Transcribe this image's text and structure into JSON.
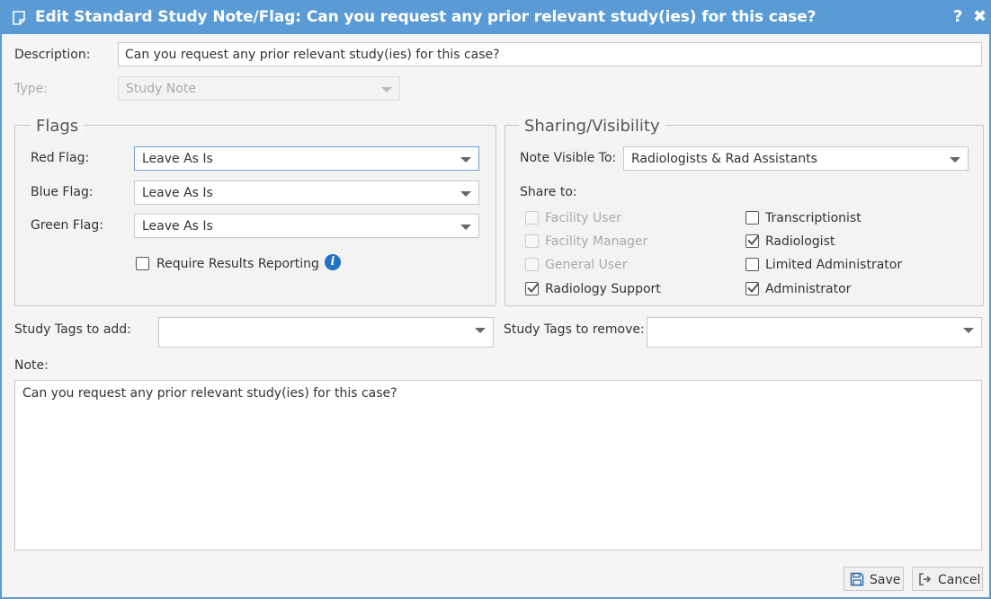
{
  "window": {
    "title": "Edit Standard Study Note/Flag: Can you request any prior relevant study(ies) for this case?",
    "help_label": "?",
    "close_label": "✖"
  },
  "description": {
    "label": "Description:",
    "value": "Can you request any prior relevant study(ies) for this case?"
  },
  "type": {
    "label": "Type:",
    "value": "Study Note"
  },
  "flags": {
    "legend": "Flags",
    "red": {
      "label": "Red Flag:",
      "value": "Leave As Is"
    },
    "blue": {
      "label": "Blue Flag:",
      "value": "Leave As Is"
    },
    "green": {
      "label": "Green Flag:",
      "value": "Leave As Is"
    },
    "require_results": {
      "label": "Require Results Reporting",
      "checked": false
    }
  },
  "sharing": {
    "legend": "Sharing/Visibility",
    "visible_to": {
      "label": "Note Visible To:",
      "value": "Radiologists & Rad Assistants"
    },
    "share_to_label": "Share to:",
    "options": [
      {
        "label": "Facility User",
        "checked": false,
        "disabled": true
      },
      {
        "label": "Transcriptionist",
        "checked": false,
        "disabled": false
      },
      {
        "label": "Facility Manager",
        "checked": false,
        "disabled": true
      },
      {
        "label": "Radiologist",
        "checked": true,
        "disabled": false
      },
      {
        "label": "General User",
        "checked": false,
        "disabled": true
      },
      {
        "label": "Limited Administrator",
        "checked": false,
        "disabled": false
      },
      {
        "label": "Radiology Support",
        "checked": true,
        "disabled": false
      },
      {
        "label": "Administrator",
        "checked": true,
        "disabled": false
      }
    ]
  },
  "tags": {
    "add_label": "Study Tags to add:",
    "add_value": "",
    "remove_label": "Study Tags to remove:",
    "remove_value": ""
  },
  "note": {
    "label": "Note:",
    "value": "Can you request any prior relevant study(ies) for this case?"
  },
  "footer": {
    "save_label": "Save",
    "cancel_label": "Cancel"
  },
  "colors": {
    "titlebar": "#5b9bd5",
    "info": "#1f72c4"
  }
}
